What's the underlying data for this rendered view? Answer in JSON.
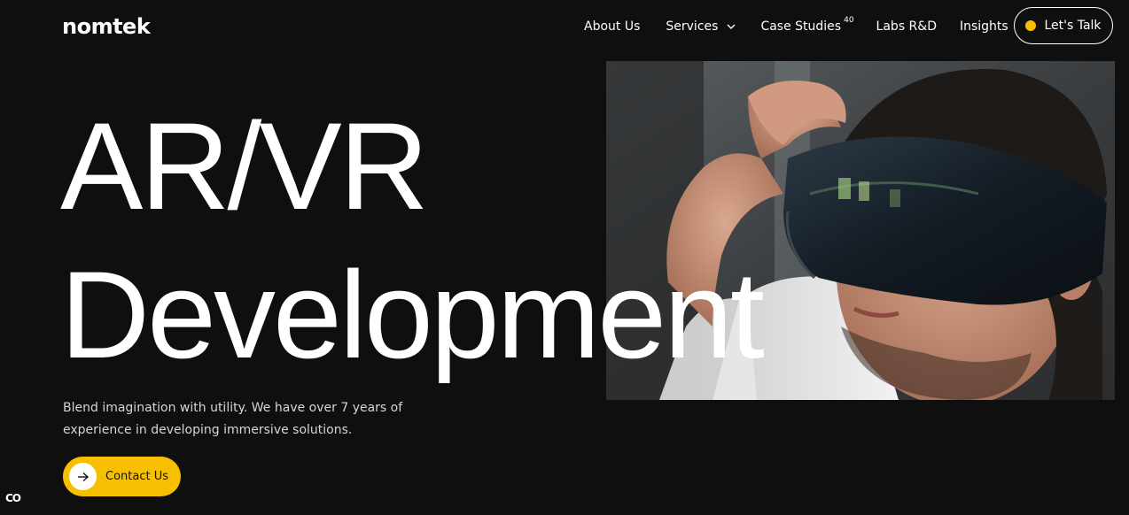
{
  "brand": {
    "logo_text": "nomtek"
  },
  "nav": {
    "items": [
      {
        "label": "About Us"
      },
      {
        "label": "Services"
      },
      {
        "label": "Case Studies",
        "badge": "40"
      },
      {
        "label": "Labs R&D"
      },
      {
        "label": "Insights"
      }
    ],
    "cta_label": "Let's Talk"
  },
  "hero": {
    "title_line1": "AR/VR",
    "title_line2": "Development",
    "description": "Blend imagination with utility. We have over 7 years of experience in developing immersive solutions.",
    "button_label": "Contact Us",
    "image_icon": "person-wearing-vr-headset-photo"
  },
  "corner_badge": "CO",
  "colors": {
    "background": "#0f0f0f",
    "accent": "#f6c000",
    "text": "#ffffff"
  }
}
